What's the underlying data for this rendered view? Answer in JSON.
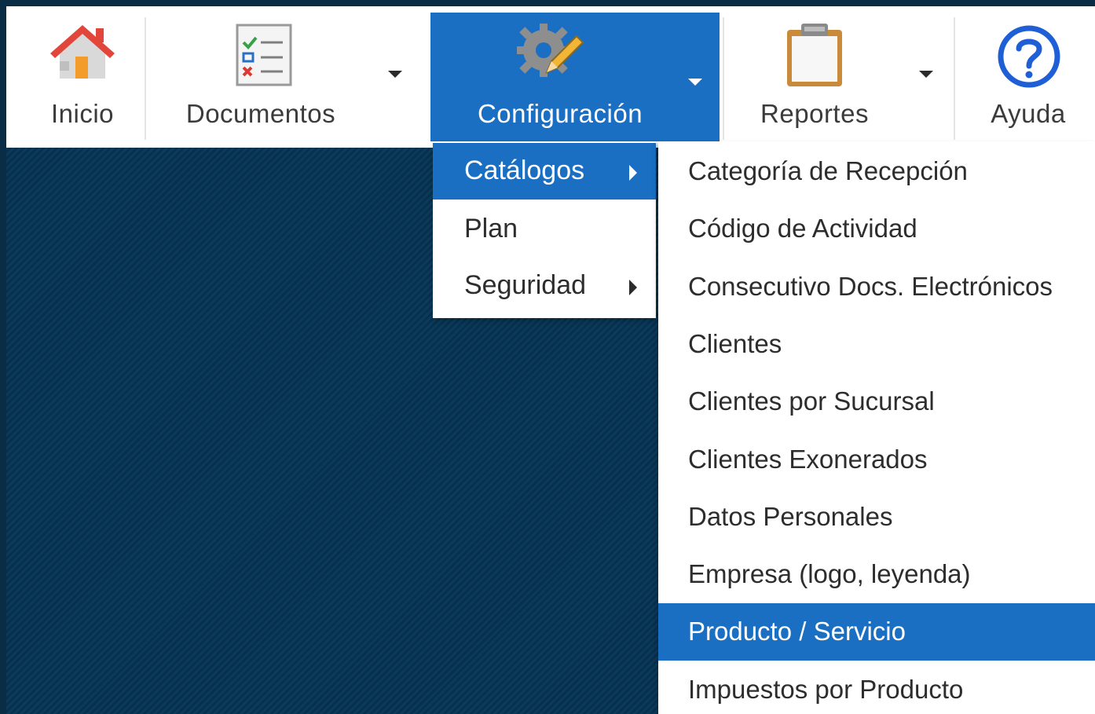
{
  "toolbar": {
    "items": [
      {
        "label": "Inicio",
        "icon": "home-icon"
      },
      {
        "label": "Documentos",
        "icon": "checklist-document-icon",
        "has_dropdown": true
      },
      {
        "label": "Configuración",
        "icon": "gear-pencil-icon",
        "has_dropdown": true,
        "active": true
      },
      {
        "label": "Reportes",
        "icon": "clipboard-icon",
        "has_dropdown": true
      },
      {
        "label": "Ayuda",
        "icon": "help-circle-icon"
      }
    ]
  },
  "config_menu": {
    "items": [
      {
        "label": "Catálogos",
        "has_submenu": true,
        "active": true
      },
      {
        "label": "Plan",
        "has_submenu": false
      },
      {
        "label": "Seguridad",
        "has_submenu": true
      }
    ]
  },
  "catalogos_submenu": {
    "items": [
      {
        "label": "Categoría de Recepción"
      },
      {
        "label": "Código de Actividad"
      },
      {
        "label": "Consecutivo Docs. Electrónicos"
      },
      {
        "label": "Clientes"
      },
      {
        "label": "Clientes por Sucursal"
      },
      {
        "label": "Clientes Exonerados"
      },
      {
        "label": "Datos Personales"
      },
      {
        "label": "Empresa (logo, leyenda)"
      },
      {
        "label": "Producto / Servicio",
        "active": true
      },
      {
        "label": "Impuestos por Producto"
      }
    ]
  },
  "colors": {
    "accent": "#1b6fc2",
    "background": "#0a3553",
    "menu_bg": "#ffffff",
    "text": "#2d2d2d"
  }
}
